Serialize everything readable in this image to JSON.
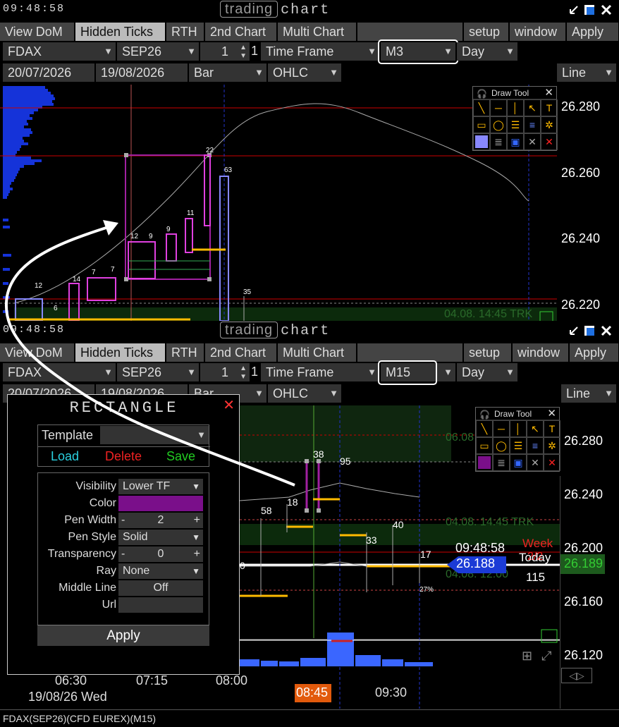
{
  "top": {
    "clock": "09:48:58",
    "title_box": "trading",
    "title_text": "chart",
    "tabs": [
      "View DoM",
      "Hidden Ticks",
      "RTH",
      "2nd Chart",
      "Multi Chart"
    ],
    "right_buttons": [
      "setup",
      "window",
      "Apply"
    ],
    "symbol": "FDAX",
    "expiry": "SEP26",
    "qty": "1",
    "qty_extra": "1",
    "timeframe_label": "Time Frame",
    "timeframe": "M3",
    "session": "Day",
    "from_date": "20/07/2026",
    "to_date": "19/08/2026",
    "bar_type": "Bar",
    "ohlc": "OHLC",
    "line": "Line",
    "prices": [
      "26.280",
      "26.260",
      "26.240",
      "26.220"
    ],
    "labels": [
      "22",
      "63",
      "12",
      "9",
      "9",
      "11",
      "14",
      "7",
      "7",
      "12",
      "6",
      "35"
    ],
    "zone_label": "04.08. 14:45 TRK"
  },
  "bottom": {
    "clock": "09:48:58",
    "title_box": "trading",
    "title_text": "chart",
    "tabs": [
      "View DoM",
      "Hidden Ticks",
      "RTH",
      "2nd Chart",
      "Multi Chart"
    ],
    "right_buttons": [
      "setup",
      "window",
      "Apply"
    ],
    "symbol": "FDAX",
    "expiry": "SEP26",
    "qty": "1",
    "qty_extra": "1",
    "timeframe_label": "Time Frame",
    "timeframe": "M15",
    "session": "Day",
    "from_date": "20/07/2026",
    "to_date": "19/08/2026",
    "bar_type": "Bar",
    "ohlc": "OHLC",
    "line": "Line",
    "prices": [
      "26.280",
      "26.240",
      "26.200",
      "26.160",
      "26.120"
    ],
    "labels": [
      "38",
      "95",
      "58",
      "18",
      "40",
      "33",
      "17",
      "0"
    ],
    "pct": "27%",
    "zone_label_1": "06.08",
    "zone_label_2": "04.08. 14:45 TRK",
    "zone_label_3": "04.08. 12:00",
    "current_time": "09:48:58",
    "week_label": "Week",
    "week_value": "2/2",
    "today_label": "Today",
    "today_value": "115",
    "last_price": "26.188",
    "last_price_right": "26.189",
    "time_ticks": [
      "06:30",
      "07:15",
      "08:00",
      "08:45",
      "09:30"
    ],
    "date_label": "19/08/26 Wed",
    "status": "FDAX(SEP26)(CFD EUREX)(M15)"
  },
  "drawtool": {
    "title": "Draw Tool",
    "close": "✕"
  },
  "dialog": {
    "title": "RECTANGLE",
    "template_label": "Template",
    "load": "Load",
    "delete": "Delete",
    "save": "Save",
    "visibility_label": "Visibility",
    "visibility_value": "Lower TF",
    "color_label": "Color",
    "color_value": "#7a0f8a",
    "pen_width_label": "Pen Width",
    "pen_width_value": "2",
    "pen_style_label": "Pen Style",
    "pen_style_value": "Solid",
    "transparency_label": "Transparency",
    "transparency_value": "0",
    "ray_label": "Ray",
    "ray_value": "None",
    "middle_line_label": "Middle Line",
    "middle_line_value": "Off",
    "url_label": "Url",
    "apply": "Apply"
  }
}
